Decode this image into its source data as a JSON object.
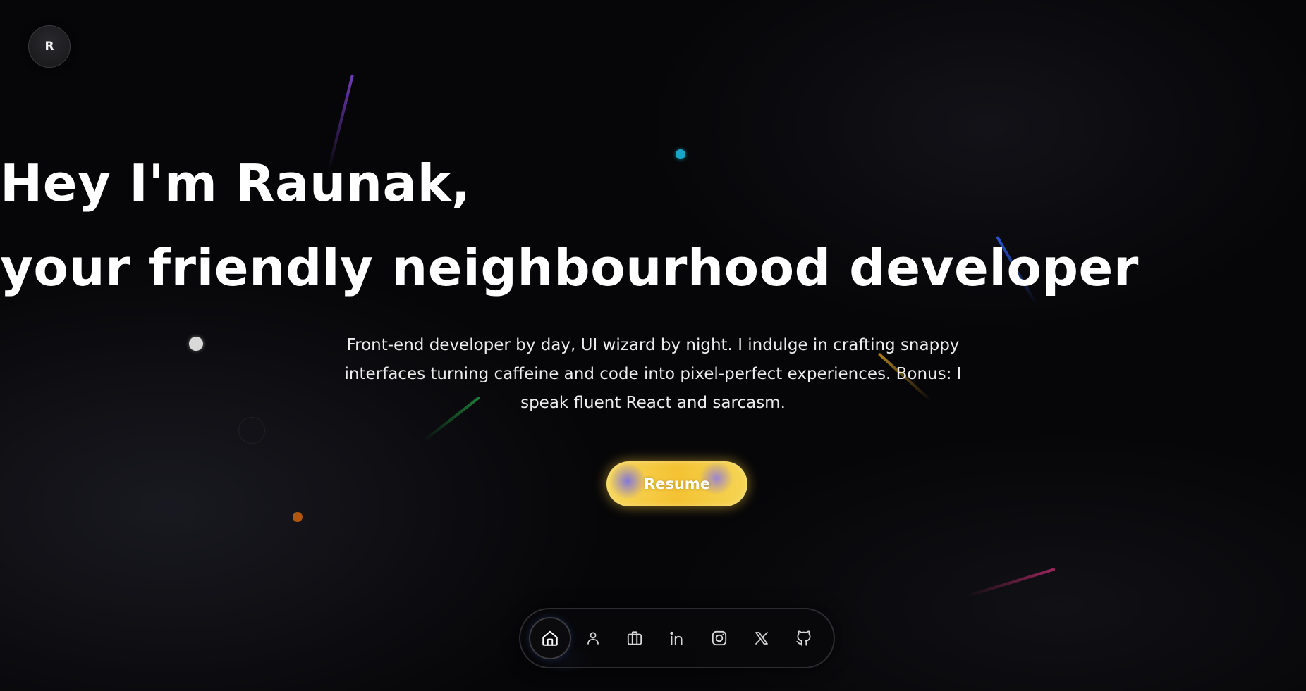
{
  "logo": {
    "letter": "R"
  },
  "hero": {
    "line1": "Hey I'm Raunak,",
    "line2": "your friendly neighbourhood developer",
    "intro": "Front-end developer by day, UI wizard by night. I indulge in crafting snappy interfaces turning caffeine and code into pixel-perfect experiences. Bonus: I speak fluent React and sarcasm."
  },
  "resume_button": {
    "label": "Resume"
  },
  "dock": {
    "items": [
      {
        "icon": "home-icon",
        "active": true
      },
      {
        "icon": "user-icon",
        "active": false
      },
      {
        "icon": "briefcase-icon",
        "active": false
      },
      {
        "icon": "linkedin-icon",
        "active": false
      },
      {
        "icon": "instagram-icon",
        "active": false
      },
      {
        "icon": "x-twitter-icon",
        "active": false
      },
      {
        "icon": "github-icon",
        "active": false
      }
    ]
  },
  "colors": {
    "background": "#060608",
    "accent_yellow": "#f4c233",
    "accent_purple": "#7b6ee6",
    "text": "#ffffff"
  }
}
